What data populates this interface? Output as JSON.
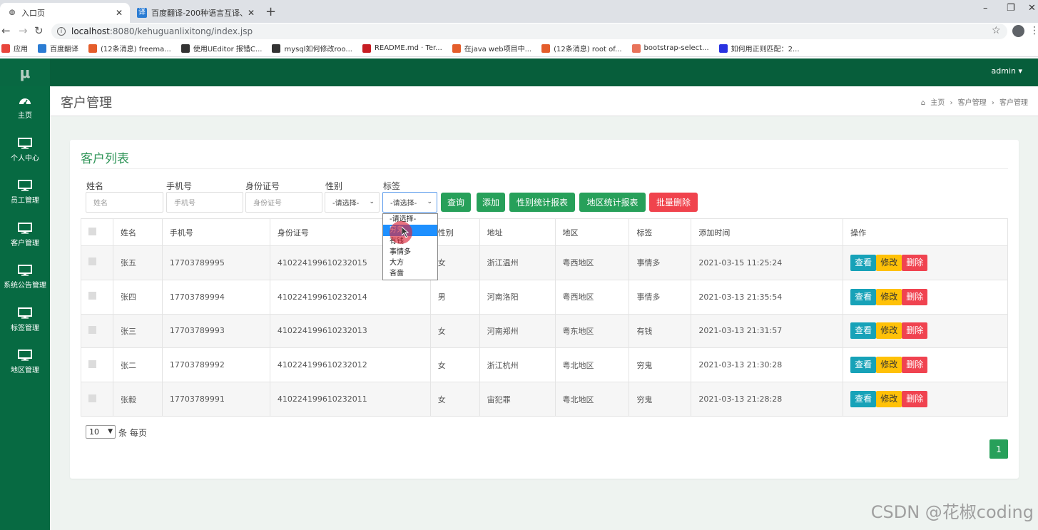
{
  "browser": {
    "tabs": [
      {
        "title": "入口页",
        "active": true
      },
      {
        "title": "百度翻译-200种语言互译、沟通全",
        "active": false
      }
    ],
    "url_host": "localhost",
    "url_rest": ":8080/kehuguanlixitong/index.jsp",
    "bookmarks": [
      {
        "label": "应用",
        "icon": "apps-icon",
        "color": "#e8453c"
      },
      {
        "label": "百度翻译",
        "icon": "translate-icon",
        "color": "#2b7cd3"
      },
      {
        "label": "(12条消息) freema...",
        "icon": "csdn-icon",
        "color": "#e45d2b"
      },
      {
        "label": "使用UEditor 报错C...",
        "icon": "ueditor-icon",
        "color": "#333333"
      },
      {
        "label": "mysql如何修改roo...",
        "icon": "ueditor-icon",
        "color": "#333333"
      },
      {
        "label": "README.md · Ter...",
        "icon": "gitee-icon",
        "color": "#c71d23"
      },
      {
        "label": "在java web项目中...",
        "icon": "csdn-icon",
        "color": "#e45d2b"
      },
      {
        "label": "(12条消息) root of...",
        "icon": "csdn-icon",
        "color": "#e45d2b"
      },
      {
        "label": "bootstrap-select...",
        "icon": "jianshu-icon",
        "color": "#e8735a"
      },
      {
        "label": "如何用正则匹配：2...",
        "icon": "baidu-icon",
        "color": "#2932e1"
      }
    ]
  },
  "app": {
    "logo": "μ",
    "user_menu": "admin ▾",
    "sidebar": [
      {
        "label": "主页",
        "icon": "dashboard-icon"
      },
      {
        "label": "个人中心",
        "icon": "monitor-icon"
      },
      {
        "label": "员工管理",
        "icon": "monitor-icon"
      },
      {
        "label": "客户管理",
        "icon": "monitor-icon"
      },
      {
        "label": "系统公告管理",
        "icon": "monitor-icon"
      },
      {
        "label": "标签管理",
        "icon": "monitor-icon"
      },
      {
        "label": "地区管理",
        "icon": "monitor-icon"
      }
    ],
    "page_title": "客户管理",
    "breadcrumb": [
      "主页",
      "客户管理",
      "客户管理"
    ]
  },
  "card": {
    "title": "客户列表",
    "filters": {
      "name_label": "姓名",
      "name_placeholder": "姓名",
      "phone_label": "手机号",
      "phone_placeholder": "手机号",
      "id_label": "身份证号",
      "id_placeholder": "身份证号",
      "gender_label": "性别",
      "gender_value": "-请选择-",
      "tag_label": "标签",
      "tag_value": "-请选择-"
    },
    "buttons": {
      "search": "查询",
      "add": "添加",
      "gender_report": "性别统计报表",
      "region_report": "地区统计报表",
      "batch_delete": "批量删除"
    },
    "columns": [
      "姓名",
      "手机号",
      "身份证号",
      "性别",
      "地址",
      "地区",
      "标签",
      "添加时间",
      "操作"
    ],
    "rows": [
      {
        "name": "张五",
        "phone": "17703789995",
        "id": "410224199610232015",
        "gender": "女",
        "address": "浙江温州",
        "region": "粤西地区",
        "tag": "事情多",
        "time": "2021-03-15 11:25:24"
      },
      {
        "name": "张四",
        "phone": "17703789994",
        "id": "410224199610232014",
        "gender": "男",
        "address": "河南洛阳",
        "region": "粤西地区",
        "tag": "事情多",
        "time": "2021-03-13 21:35:54"
      },
      {
        "name": "张三",
        "phone": "17703789993",
        "id": "410224199610232013",
        "gender": "女",
        "address": "河南郑州",
        "region": "粤东地区",
        "tag": "有钱",
        "time": "2021-03-13 21:31:57"
      },
      {
        "name": "张二",
        "phone": "17703789992",
        "id": "410224199610232012",
        "gender": "女",
        "address": "浙江杭州",
        "region": "粤北地区",
        "tag": "穷鬼",
        "time": "2021-03-13 21:30:28"
      },
      {
        "name": "张毅",
        "phone": "17703789991",
        "id": "410224199610232011",
        "gender": "女",
        "address": "宙犯罪",
        "region": "粤北地区",
        "tag": "穷鬼",
        "time": "2021-03-13 21:28:28"
      }
    ],
    "row_actions": {
      "view": "查看",
      "edit": "修改",
      "delete": "删除"
    },
    "page_size": "10",
    "page_size_suffix": "条 每页",
    "current_page": "1"
  },
  "tag_dropdown": {
    "options": [
      "-请选择-",
      "穷鬼",
      "有钱",
      "事情多",
      "大方",
      "吝啬"
    ],
    "highlighted_index": 1
  },
  "watermark": "CSDN @花椒coding"
}
